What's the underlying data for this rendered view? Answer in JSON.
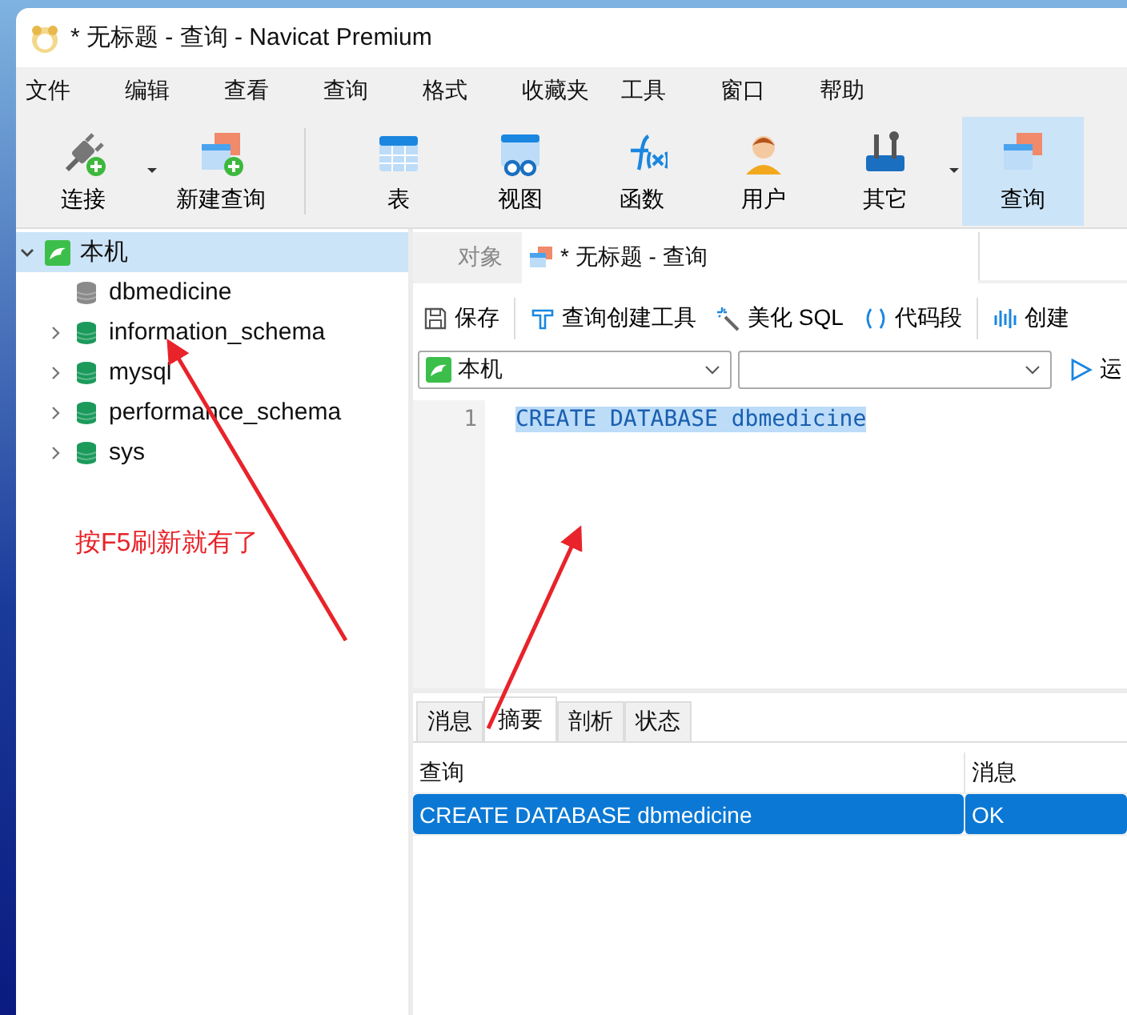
{
  "window": {
    "title": "* 无标题 - 查询 - Navicat Premium"
  },
  "menu": [
    "文件",
    "编辑",
    "查看",
    "查询",
    "格式",
    "收藏夹",
    "工具",
    "窗口",
    "帮助"
  ],
  "toolbar": [
    {
      "label": "连接",
      "kind": "connect",
      "dropdown": true,
      "selected": false
    },
    {
      "label": "新建查询",
      "kind": "new-query",
      "dropdown": false,
      "selected": false
    },
    {
      "label": "表",
      "kind": "table",
      "dropdown": false,
      "selected": false
    },
    {
      "label": "视图",
      "kind": "view",
      "dropdown": false,
      "selected": false
    },
    {
      "label": "函数",
      "kind": "function",
      "dropdown": false,
      "selected": false
    },
    {
      "label": "用户",
      "kind": "user",
      "dropdown": false,
      "selected": false
    },
    {
      "label": "其它",
      "kind": "tools",
      "dropdown": true,
      "selected": false
    },
    {
      "label": "查询",
      "kind": "query",
      "dropdown": false,
      "selected": true
    }
  ],
  "tree": [
    {
      "label": "本机",
      "expanded": true,
      "selected": true,
      "children": [
        {
          "label": "dbmedicine",
          "color": "#8a8a8a",
          "expandable": false
        },
        {
          "label": "information_schema",
          "color": "#1c9a5c",
          "expandable": true
        },
        {
          "label": "mysql",
          "color": "#1c9a5c",
          "expandable": true
        },
        {
          "label": "performance_schema",
          "color": "#1c9a5c",
          "expandable": true
        },
        {
          "label": "sys",
          "color": "#1c9a5c",
          "expandable": true
        }
      ]
    }
  ],
  "annotation": {
    "text": "按F5刷新就有了"
  },
  "tabs": [
    {
      "label": "对象",
      "selected": false
    },
    {
      "label": "* 无标题 - 查询",
      "selected": true
    }
  ],
  "query_toolbar": [
    {
      "label": "保存",
      "kind": "save"
    },
    {
      "label": "查询创建工具",
      "kind": "builder"
    },
    {
      "label": "美化 SQL",
      "kind": "beautify"
    },
    {
      "label": "代码段",
      "kind": "snippet"
    },
    {
      "label": "创建",
      "kind": "chart"
    }
  ],
  "connection_select": {
    "value": "本机"
  },
  "run_button": {
    "label": "运"
  },
  "editor": {
    "lines": [
      {
        "number": "1",
        "code": "CREATE DATABASE dbmedicine",
        "selected": true
      }
    ]
  },
  "result_tabs": [
    {
      "label": "消息",
      "selected": false
    },
    {
      "label": "摘要",
      "selected": true
    },
    {
      "label": "剖析",
      "selected": false
    },
    {
      "label": "状态",
      "selected": false
    }
  ],
  "result_table": {
    "columns": [
      "查询",
      "消息"
    ],
    "rows": [
      {
        "cells": [
          "CREATE DATABASE dbmedicine",
          "OK"
        ],
        "selected": true
      }
    ]
  }
}
